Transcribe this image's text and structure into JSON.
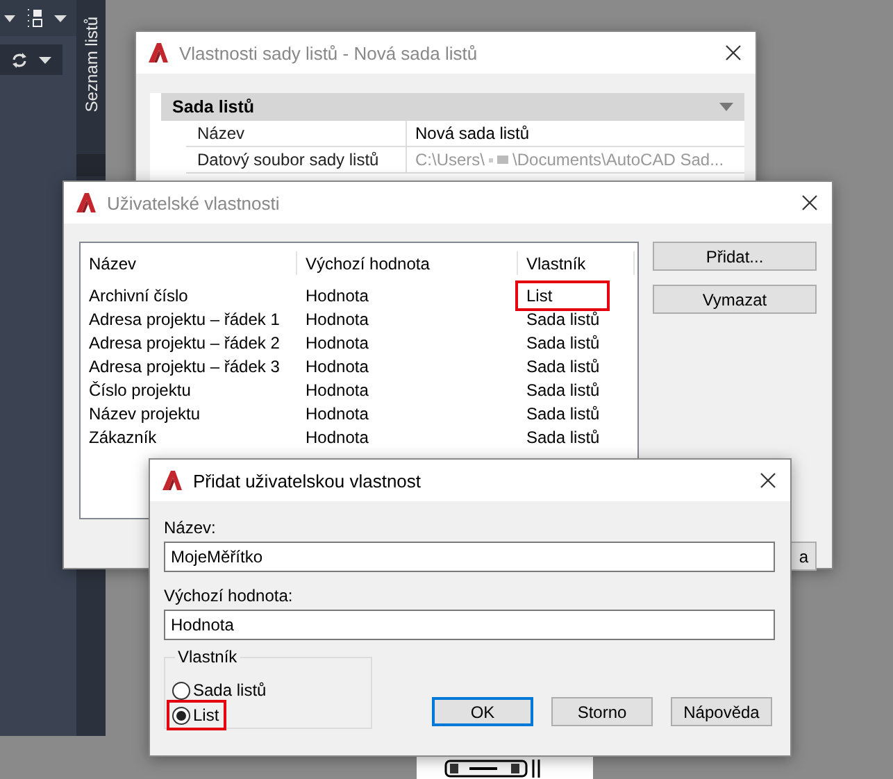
{
  "side_panel": {
    "tab_label": "Seznam listů"
  },
  "sheet_set_window": {
    "title": "Vlastnosti sady listů - Nová sada listů",
    "section": "Sada listů",
    "rows": [
      {
        "kind": "text",
        "name": "Název",
        "value": "Nová sada listů"
      },
      {
        "kind": "redacted_path",
        "name": "Datový soubor sady listů",
        "value_parts": [
          "C:\\Users\\",
          "\\Documents\\AutoCAD Sad..."
        ]
      }
    ]
  },
  "custom_props_window": {
    "title": "Uživatelské vlastnosti",
    "columns": [
      "Název",
      "Výchozí hodnota",
      "Vlastník"
    ],
    "rows": [
      {
        "cells": [
          "Archivní číslo",
          "Hodnota",
          "List"
        ],
        "highlighted": true
      },
      {
        "cells": [
          "Adresa projektu – řádek 1",
          "Hodnota",
          "Sada listů"
        ],
        "highlighted": false
      },
      {
        "cells": [
          "Adresa projektu – řádek 2",
          "Hodnota",
          "Sada listů"
        ],
        "highlighted": false
      },
      {
        "cells": [
          "Adresa projektu – řádek 3",
          "Hodnota",
          "Sada listů"
        ],
        "highlighted": false
      },
      {
        "cells": [
          "Číslo projektu",
          "Hodnota",
          "Sada listů"
        ],
        "highlighted": false
      },
      {
        "cells": [
          "Název projektu",
          "Hodnota",
          "Sada listů"
        ],
        "highlighted": false
      },
      {
        "cells": [
          "Zákazník",
          "Hodnota",
          "Sada listů"
        ],
        "highlighted": false
      }
    ],
    "buttons": [
      "Přidat...",
      "Vymazat"
    ],
    "covered_button_text": "a"
  },
  "add_dialog": {
    "title": "Přidat uživatelskou vlastnost",
    "fields": [
      {
        "label": "Název:",
        "value": "MojeMěřítko"
      },
      {
        "label": "Výchozí hodnota:",
        "value": "Hodnota"
      }
    ],
    "owner": {
      "label": "Vlastník",
      "options": [
        {
          "label": "Sada listů",
          "selected": false,
          "highlighted": false
        },
        {
          "label": "List",
          "selected": true,
          "highlighted": true
        }
      ]
    },
    "buttons": [
      {
        "label": "OK",
        "default": true
      },
      {
        "label": "Storno",
        "default": false
      },
      {
        "label": "Nápověda",
        "default": false
      }
    ]
  }
}
